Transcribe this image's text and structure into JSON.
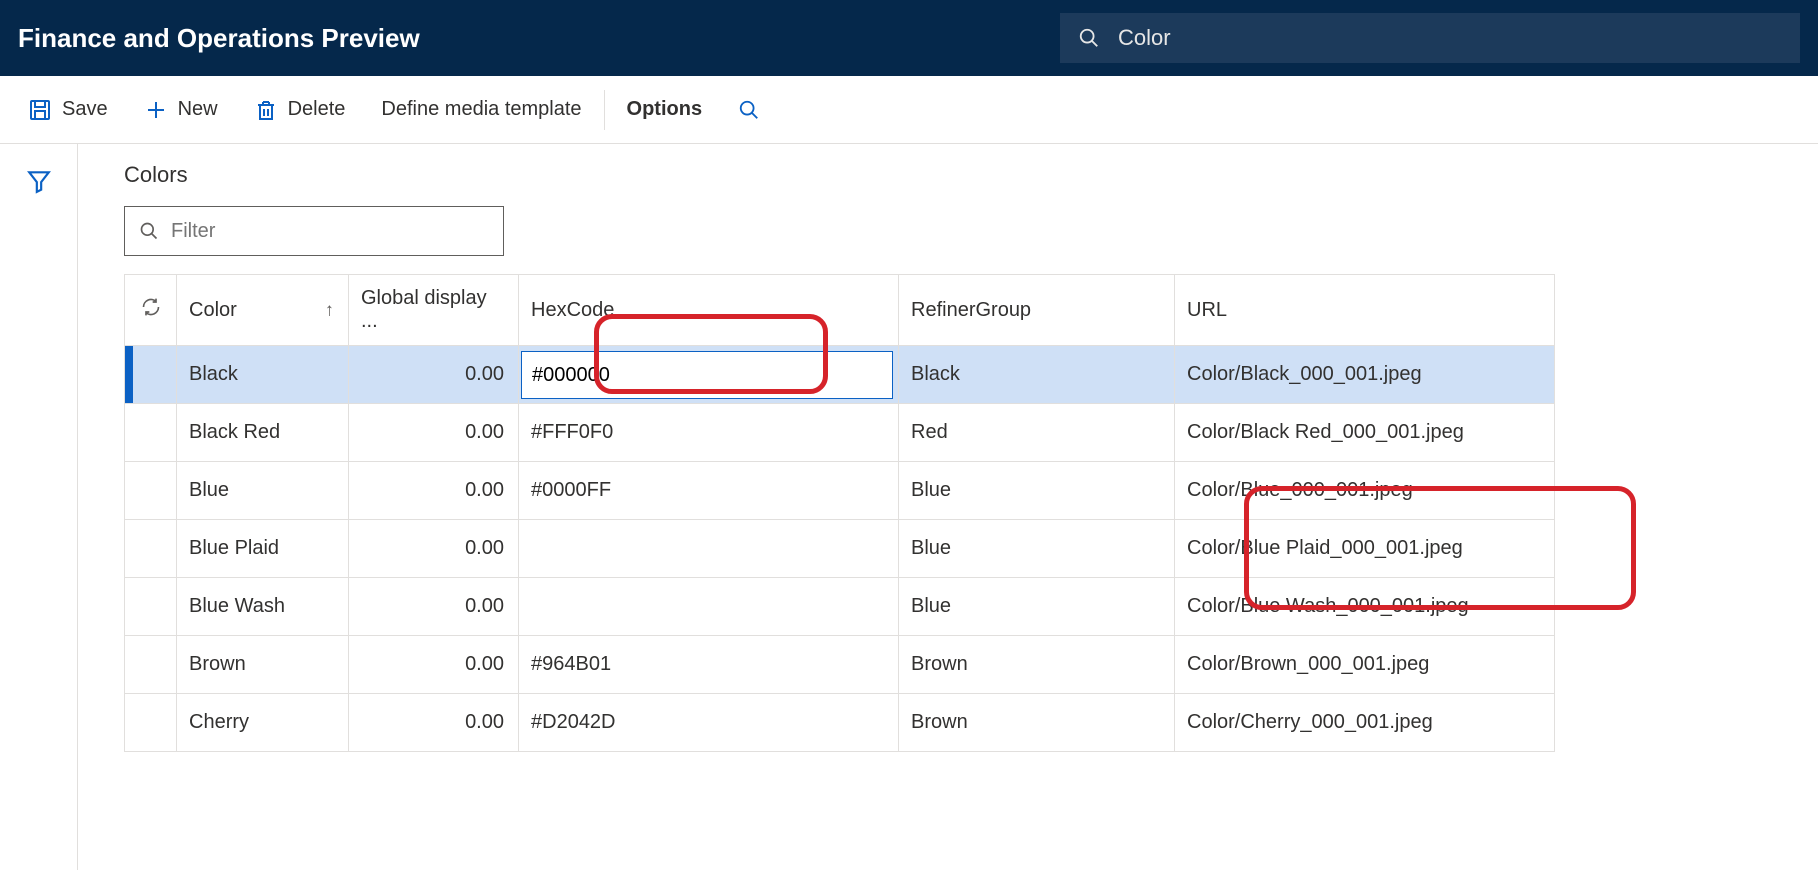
{
  "header": {
    "title": "Finance and Operations Preview",
    "search_value": "Color"
  },
  "toolbar": {
    "save": "Save",
    "new": "New",
    "delete": "Delete",
    "define_media": "Define media template",
    "options": "Options"
  },
  "section": {
    "title": "Colors"
  },
  "filter": {
    "placeholder": "Filter"
  },
  "columns": {
    "color": "Color",
    "display": "Global display ...",
    "hex": "HexCode",
    "refiner": "RefinerGroup",
    "url": "URL"
  },
  "rows": [
    {
      "color": "Black",
      "display": "0.00",
      "hex": "#000000",
      "refiner": "Black",
      "url": "Color/Black_000_001.jpeg",
      "selected": true
    },
    {
      "color": "Black Red",
      "display": "0.00",
      "hex": "#FFF0F0",
      "refiner": "Red",
      "url": "Color/Black Red_000_001.jpeg"
    },
    {
      "color": "Blue",
      "display": "0.00",
      "hex": "#0000FF",
      "refiner": "Blue",
      "url": "Color/Blue_000_001.jpeg"
    },
    {
      "color": "Blue Plaid",
      "display": "0.00",
      "hex": "",
      "refiner": "Blue",
      "url": "Color/Blue Plaid_000_001.jpeg"
    },
    {
      "color": "Blue Wash",
      "display": "0.00",
      "hex": "",
      "refiner": "Blue",
      "url": "Color/Blue Wash_000_001.jpeg"
    },
    {
      "color": "Brown",
      "display": "0.00",
      "hex": "#964B01",
      "refiner": "Brown",
      "url": "Color/Brown_000_001.jpeg"
    },
    {
      "color": "Cherry",
      "display": "0.00",
      "hex": "#D2042D",
      "refiner": "Brown",
      "url": "Color/Cherry_000_001.jpeg"
    }
  ]
}
